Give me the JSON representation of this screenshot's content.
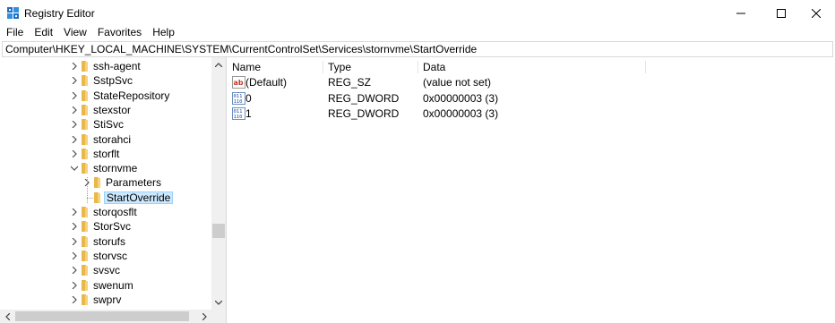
{
  "window": {
    "title": "Registry Editor",
    "minimize_glyph": "—",
    "maximize_glyph": "☐",
    "close_glyph": "✕"
  },
  "menu": [
    "File",
    "Edit",
    "View",
    "Favorites",
    "Help"
  ],
  "address": "Computer\\HKEY_LOCAL_MACHINE\\SYSTEM\\CurrentControlSet\\Services\\stornvme\\StartOverride",
  "tree": {
    "items": [
      {
        "label": "ssh-agent",
        "expander": "collapsed",
        "level": 0
      },
      {
        "label": "SstpSvc",
        "expander": "collapsed",
        "level": 0
      },
      {
        "label": "StateRepository",
        "expander": "collapsed",
        "level": 0
      },
      {
        "label": "stexstor",
        "expander": "collapsed",
        "level": 0
      },
      {
        "label": "StiSvc",
        "expander": "collapsed",
        "level": 0
      },
      {
        "label": "storahci",
        "expander": "collapsed",
        "level": 0
      },
      {
        "label": "storflt",
        "expander": "collapsed",
        "level": 0
      },
      {
        "label": "stornvme",
        "expander": "expanded",
        "level": 0
      },
      {
        "label": "Parameters",
        "expander": "collapsed",
        "level": 1
      },
      {
        "label": "StartOverride",
        "expander": "none",
        "level": 1,
        "selected": true
      },
      {
        "label": "storqosflt",
        "expander": "collapsed",
        "level": 0
      },
      {
        "label": "StorSvc",
        "expander": "collapsed",
        "level": 0
      },
      {
        "label": "storufs",
        "expander": "collapsed",
        "level": 0
      },
      {
        "label": "storvsc",
        "expander": "collapsed",
        "level": 0
      },
      {
        "label": "svsvc",
        "expander": "collapsed",
        "level": 0
      },
      {
        "label": "swenum",
        "expander": "collapsed",
        "level": 0
      },
      {
        "label": "swprv",
        "expander": "collapsed",
        "level": 0
      }
    ]
  },
  "list": {
    "columns": {
      "name": "Name",
      "type": "Type",
      "data": "Data"
    },
    "rows": [
      {
        "icon": "string-value-icon",
        "name": "(Default)",
        "type": "REG_SZ",
        "data": "(value not set)"
      },
      {
        "icon": "dword-value-icon",
        "name": "0",
        "type": "REG_DWORD",
        "data": "0x00000003 (3)"
      },
      {
        "icon": "dword-value-icon",
        "name": "1",
        "type": "REG_DWORD",
        "data": "0x00000003 (3)"
      }
    ]
  },
  "colors": {
    "selection_bg": "#cce8ff",
    "selection_border": "#99d1ff",
    "folder": "#e8b84a"
  }
}
